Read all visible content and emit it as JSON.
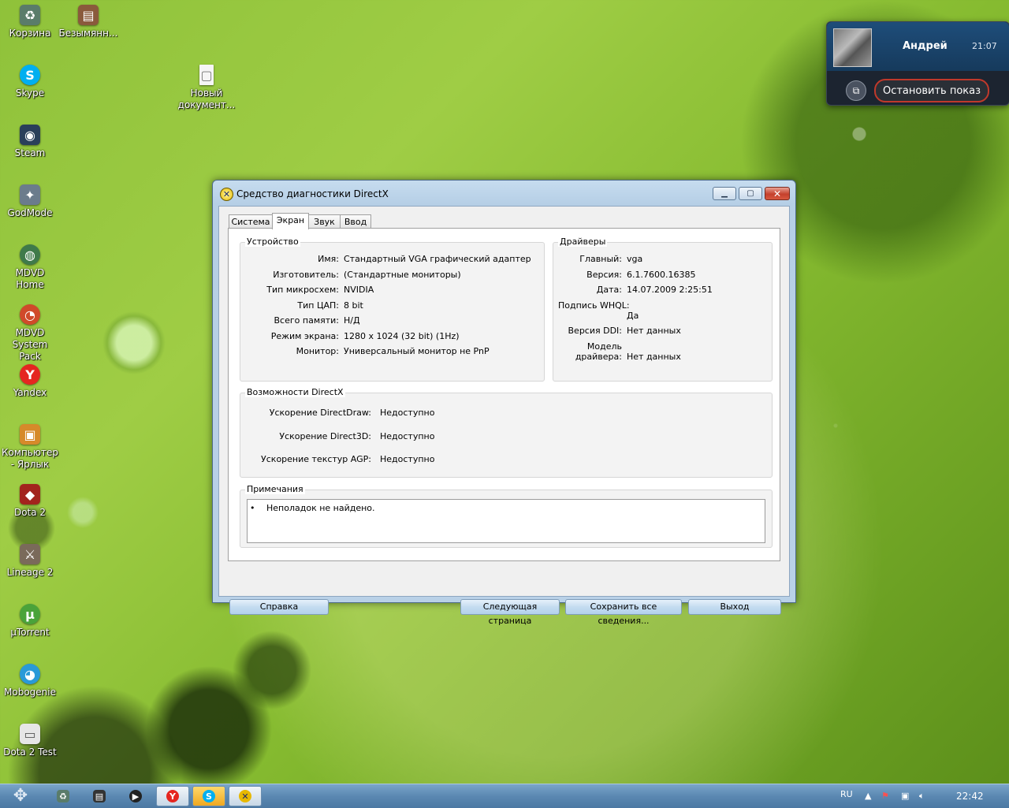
{
  "desktop": {
    "icons": [
      {
        "label": "Корзина",
        "color": "#5a7c6a",
        "glyph": "♻"
      },
      {
        "label": "Безымянн...",
        "color": "#8a5a3c",
        "glyph": "▤"
      },
      {
        "label": "Skype",
        "color": "#00aff0",
        "glyph": "S"
      },
      {
        "label": "Новый документ...",
        "color": "#f5f5f5",
        "glyph": "▢"
      },
      {
        "label": "Steam",
        "color": "#2a3f5a",
        "glyph": "◉"
      },
      {
        "label": "GodMode",
        "color": "#6b7c8c",
        "glyph": "✦"
      },
      {
        "label": "MDVD Home",
        "color": "#3f7a4a",
        "glyph": "◍"
      },
      {
        "label": "MDVD System Pack",
        "color": "#d04a2a",
        "glyph": "◔"
      },
      {
        "label": "Yandex",
        "color": "#e52620",
        "glyph": "Y"
      },
      {
        "label": "Компьютер - Ярлык",
        "color": "#d68a2a",
        "glyph": "▣"
      },
      {
        "label": "Dota 2",
        "color": "#a3231d",
        "glyph": "◆"
      },
      {
        "label": "Lineage 2",
        "color": "#7a6a5a",
        "glyph": "⚔"
      },
      {
        "label": "µTorrent",
        "color": "#4aa33a",
        "glyph": "µ"
      },
      {
        "label": "Mobogenie",
        "color": "#2a9ad8",
        "glyph": "◕"
      },
      {
        "label": "Dota 2 Test",
        "color": "#e6e6e6",
        "glyph": "▭"
      }
    ]
  },
  "notification": {
    "name": "Андрей",
    "time": "21:07",
    "stop_label": "Остановить показ"
  },
  "window": {
    "title": "Средство диагностики DirectX",
    "tabs": [
      {
        "label": "Система"
      },
      {
        "label": "Экран"
      },
      {
        "label": "Звук"
      },
      {
        "label": "Ввод"
      }
    ],
    "device": {
      "title": "Устройство",
      "rows": [
        {
          "label": "Имя:",
          "value": "Стандартный VGA графический адаптер"
        },
        {
          "label": "Изготовитель:",
          "value": "(Стандартные мониторы)"
        },
        {
          "label": "Тип микросхем:",
          "value": "NVIDIA"
        },
        {
          "label": "Тип ЦАП:",
          "value": "8 bit"
        },
        {
          "label": "Всего памяти:",
          "value": "Н/Д"
        },
        {
          "label": "Режим экрана:",
          "value": "1280 x 1024 (32 bit) (1Hz)"
        },
        {
          "label": "Монитор:",
          "value": "Универсальный монитор не PnP"
        }
      ]
    },
    "drivers": {
      "title": "Драйверы",
      "main_label": "Главный:",
      "main_value": "vga",
      "version_label": "Версия:",
      "version_value": "6.1.7600.16385",
      "date_label": "Дата:",
      "date_value": "14.07.2009 2:25:51",
      "whql_label": "Подпись WHQL:",
      "whql_value": "Да",
      "ddi_label": "Версия DDI:",
      "ddi_value": "Нет данных",
      "model_label_1": "Модель",
      "model_label_2": "драйвера:",
      "model_value": "Нет данных"
    },
    "directx": {
      "title": "Возможности DirectX",
      "rows": [
        {
          "label": "Ускорение DirectDraw:",
          "value": "Недоступно"
        },
        {
          "label": "Ускорение Direct3D:",
          "value": "Недоступно"
        },
        {
          "label": "Ускорение текстур AGP:",
          "value": "Недоступно"
        }
      ]
    },
    "notes": {
      "title": "Примечания",
      "bullet": "•",
      "text": "Неполадок не найдено."
    },
    "buttons": {
      "help": "Справка",
      "next": "Следующая страница",
      "save": "Сохранить все сведения...",
      "exit": "Выход"
    }
  },
  "taskbar": {
    "lang": "RU",
    "time": "22:42"
  }
}
